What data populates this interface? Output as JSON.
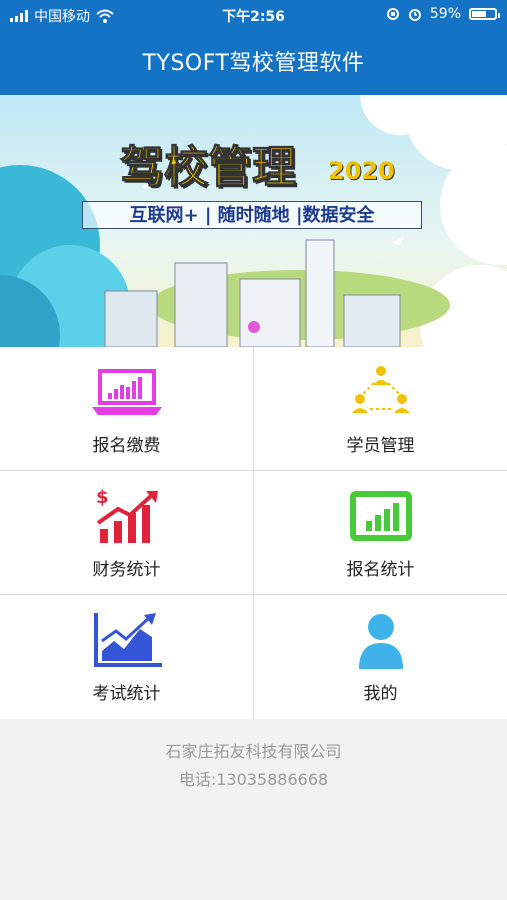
{
  "status_bar": {
    "carrier": "中国移动",
    "time": "下午2:56",
    "battery": "59%",
    "battery_level": 0.59,
    "icons": [
      "signal-icon",
      "wifi-icon",
      "rotation-lock-icon",
      "alarm-icon",
      "battery-icon"
    ]
  },
  "header": {
    "title": "TYSOFT驾校管理软件",
    "color": "#1473c4"
  },
  "banner": {
    "title": "驾校管理",
    "year": "2020",
    "tagline": "互联网+ | 随时随地 |数据安全"
  },
  "menu": {
    "items": [
      {
        "label": "报名缴费",
        "icon": "laptop-chart-icon",
        "color": "#e23de6"
      },
      {
        "label": "学员管理",
        "icon": "users-network-icon",
        "color": "#f2c200"
      },
      {
        "label": "财务统计",
        "icon": "finance-growth-icon",
        "color": "#e0233a"
      },
      {
        "label": "报名统计",
        "icon": "tablet-chart-icon",
        "color": "#46c93a"
      },
      {
        "label": "考试统计",
        "icon": "line-chart-icon",
        "color": "#3456d6"
      },
      {
        "label": "我的",
        "icon": "user-icon",
        "color": "#3fb2ea"
      }
    ]
  },
  "footer": {
    "company": "石家庄拓友科技有限公司",
    "phone": "电话:13035886668"
  }
}
